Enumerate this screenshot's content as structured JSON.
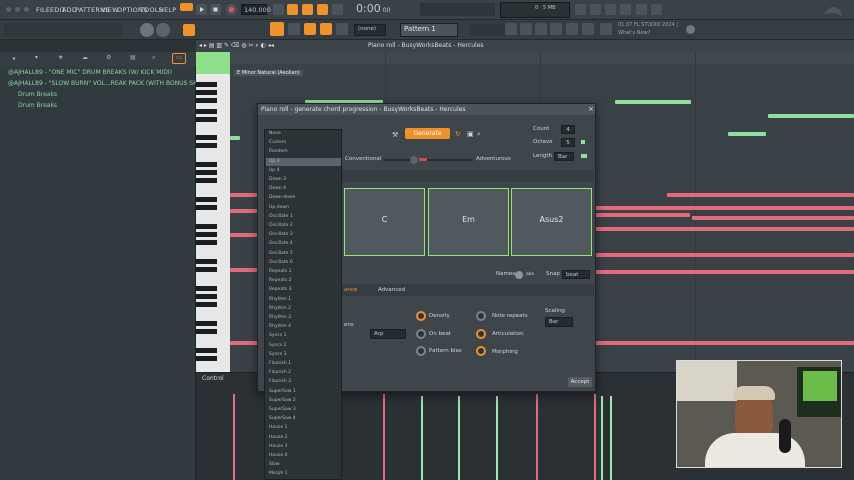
{
  "menu": [
    "FILE",
    "EDIT",
    "ADD",
    "PATTERNS",
    "VIEW",
    "OPTIONS",
    "TOOLS",
    "HELP"
  ],
  "transport": {
    "tempo": "140.000",
    "time": "0:00",
    "time_sub": "00",
    "pattern": "Pattern 1",
    "mode": "(none)"
  },
  "status": {
    "line1": "01.07 FL STUDIO 2024 |",
    "line2": "What's New?",
    "mem": "5 MB",
    "cpu": "0"
  },
  "browser": {
    "items": [
      "@AJHALL89 - \"ONE MIC\" DRUM BREAKS (W/ KICK MIDI)",
      "@AJHALL89 - \"SLOW BURN\" VOL...REAK PACK (WITH BONUS SHOTS)",
      "Drum Breaks",
      "Drum Breaks"
    ]
  },
  "piano_roll": {
    "title": "Piano roll - BusyWorksBeats - Hercules",
    "scale": "E Minor Natural (Aeolian)",
    "control": "Control"
  },
  "dialog": {
    "title": "Piano roll - generate chord progression - BusyWorksBeats - Hercules",
    "generate": "Generate",
    "count_label": "Count",
    "count": "4",
    "octave_label": "Octave",
    "octave": "5",
    "length_label": "Length",
    "length": "Bar",
    "conventional": "Conventional",
    "adventurous": "Adventurous",
    "chords": [
      "C",
      "Em",
      "Asus2"
    ],
    "names_label": "Names",
    "names_value": "abs",
    "snap_label": "Snap",
    "snap_value": "beat",
    "tabs": [
      "ance",
      "Advanced"
    ],
    "arp": "Arp",
    "knobs": {
      "density": "Density",
      "on_beat": "On beat",
      "pattern_bias": "Pattern bias",
      "note_repeats": "Note repeats",
      "articulation": "Articulation",
      "morphing": "Morphing"
    },
    "scaling_label": "Scaling",
    "scaling": "Bar",
    "accept": "Accept",
    "partial_label": "ens"
  },
  "dropdown": {
    "items": [
      "None",
      "Custom",
      "Random",
      "Up 3",
      "Up 4",
      "Down 3",
      "Down 4",
      "Down-down",
      "Up-down",
      "Oscillate 1",
      "Oscillate 2",
      "Oscillate 3",
      "Oscillate 4",
      "Oscillate 5",
      "Oscillate 6",
      "Repeats 1",
      "Repeats 2",
      "Repeats 3",
      "Rhythm 1",
      "Rhythm 2",
      "Rhythm 3",
      "Rhythm 4",
      "Syncs 1",
      "Syncs 2",
      "Syncs 3",
      "Flourish 1",
      "Flourish 2",
      "Flourish 3",
      "SuperSaw 1",
      "SuperSaw 2",
      "SuperSaw 3",
      "SuperSaw 4",
      "House 1",
      "House 2",
      "House 3",
      "House 4",
      "Slow",
      "Morph 1"
    ],
    "selected_index": 3
  },
  "colors": {
    "accent": "#f0922c",
    "note_red": "#e56b7c",
    "note_green": "#8ee0a0",
    "chord_border": "#9be27a"
  }
}
